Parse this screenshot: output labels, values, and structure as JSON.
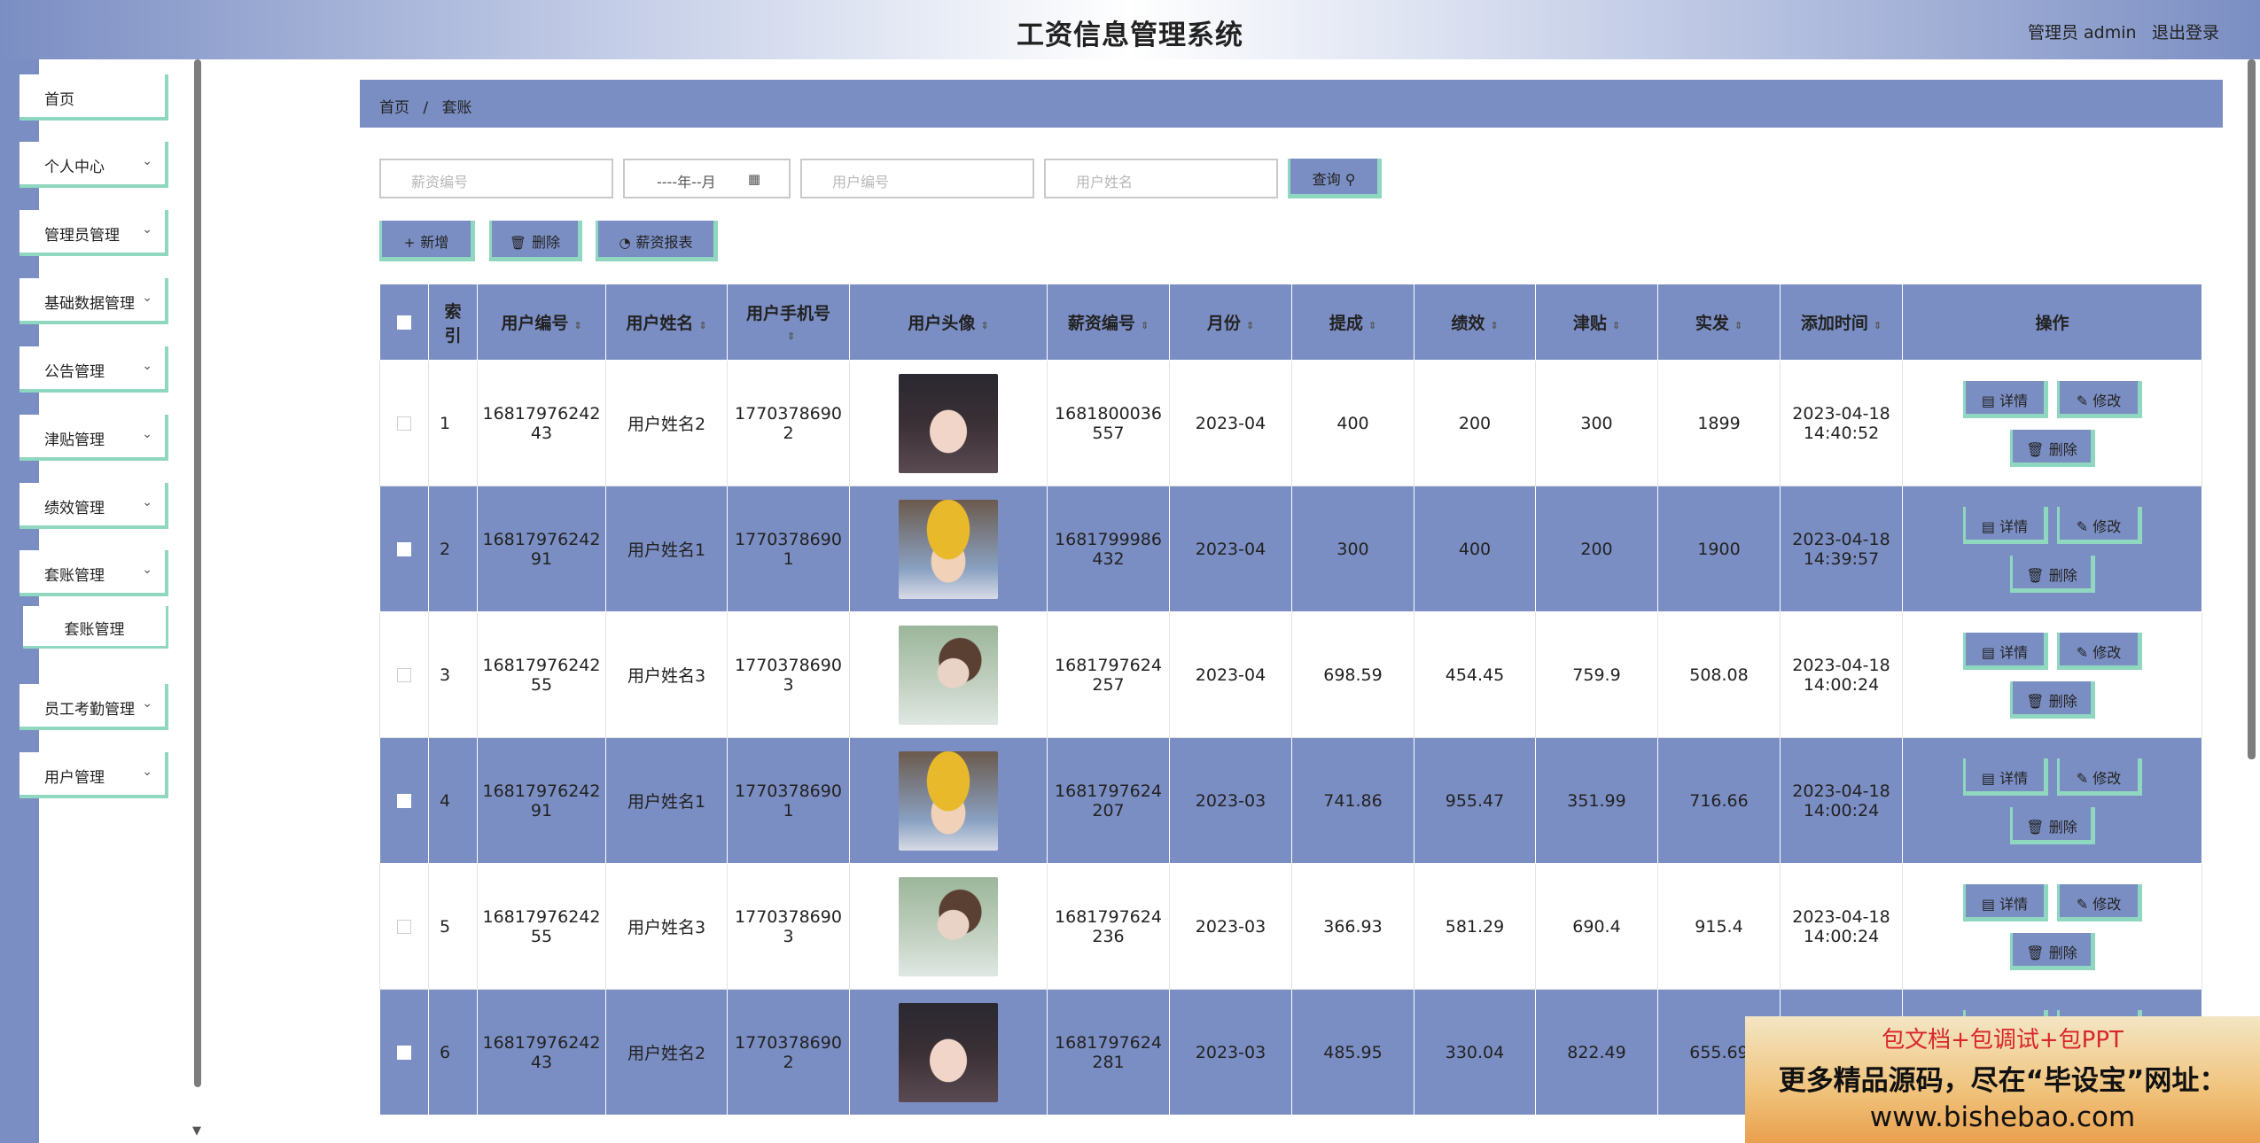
{
  "header": {
    "title": "工资信息管理系统",
    "user": "管理员 admin",
    "logout": "退出登录"
  },
  "sidebar": {
    "items": [
      {
        "label": "首页",
        "chev": ""
      },
      {
        "label": "个人中心",
        "chev": "⌄"
      },
      {
        "label": "管理员管理",
        "chev": "⌄"
      },
      {
        "label": "基础数据管理",
        "chev": "⌄"
      },
      {
        "label": "公告管理",
        "chev": "⌄"
      },
      {
        "label": "津贴管理",
        "chev": "⌄"
      },
      {
        "label": "绩效管理",
        "chev": "⌄"
      },
      {
        "label": "套账管理",
        "chev": "⌄"
      },
      {
        "label": "员工考勤管理",
        "chev": "⌄"
      },
      {
        "label": "用户管理",
        "chev": "⌄"
      }
    ],
    "sub_item": "套账管理"
  },
  "breadcrumb": {
    "home": "首页",
    "sep": "/",
    "current": "套账"
  },
  "search": {
    "salary_no_placeholder": "薪资编号",
    "month_value": "----年--月",
    "user_no_placeholder": "用户编号",
    "user_name_placeholder": "用户姓名",
    "query_label": "查询"
  },
  "actions": {
    "add": "新增",
    "delete": "删除",
    "report": "薪资报表"
  },
  "table": {
    "headers": {
      "index": "索引",
      "user_no": "用户编号",
      "user_name": "用户姓名",
      "phone": "用户手机号",
      "avatar": "用户头像",
      "salary_no": "薪资编号",
      "month": "月份",
      "commission": "提成",
      "performance": "绩效",
      "allowance": "津贴",
      "paid": "实发",
      "added": "添加时间",
      "ops": "操作"
    },
    "op_labels": {
      "detail": "详情",
      "edit": "修改",
      "delete": "删除"
    },
    "rows": [
      {
        "index": "1",
        "user_no": "1681797624243",
        "user_name": "用户姓名2",
        "phone": "17703786902",
        "avatar": "av-a",
        "salary_no": "1681800036557",
        "month": "2023-04",
        "commission": "400",
        "performance": "200",
        "allowance": "300",
        "paid": "1899",
        "date": "2023-04-18",
        "time": "14:40:52"
      },
      {
        "index": "2",
        "user_no": "1681797624291",
        "user_name": "用户姓名1",
        "phone": "17703786901",
        "avatar": "av-b",
        "salary_no": "1681799986432",
        "month": "2023-04",
        "commission": "300",
        "performance": "400",
        "allowance": "200",
        "paid": "1900",
        "date": "2023-04-18",
        "time": "14:39:57"
      },
      {
        "index": "3",
        "user_no": "1681797624255",
        "user_name": "用户姓名3",
        "phone": "17703786903",
        "avatar": "av-c",
        "salary_no": "1681797624257",
        "month": "2023-04",
        "commission": "698.59",
        "performance": "454.45",
        "allowance": "759.9",
        "paid": "508.08",
        "date": "2023-04-18",
        "time": "14:00:24"
      },
      {
        "index": "4",
        "user_no": "1681797624291",
        "user_name": "用户姓名1",
        "phone": "17703786901",
        "avatar": "av-b",
        "salary_no": "1681797624207",
        "month": "2023-03",
        "commission": "741.86",
        "performance": "955.47",
        "allowance": "351.99",
        "paid": "716.66",
        "date": "2023-04-18",
        "time": "14:00:24"
      },
      {
        "index": "5",
        "user_no": "1681797624255",
        "user_name": "用户姓名3",
        "phone": "17703786903",
        "avatar": "av-c",
        "salary_no": "1681797624236",
        "month": "2023-03",
        "commission": "366.93",
        "performance": "581.29",
        "allowance": "690.4",
        "paid": "915.4",
        "date": "2023-04-18",
        "time": "14:00:24"
      },
      {
        "index": "6",
        "user_no": "1681797624243",
        "user_name": "用户姓名2",
        "phone": "17703786902",
        "avatar": "av-a",
        "salary_no": "1681797624281",
        "month": "2023-03",
        "commission": "485.95",
        "performance": "330.04",
        "allowance": "822.49",
        "paid": "655.69",
        "date": "",
        "time": ""
      }
    ]
  },
  "watermark": {
    "line1": "包文档+包调试+包PPT",
    "line2": "更多精品源码，尽在“毕设宝”网址：",
    "line3": "www.bishebao.com"
  },
  "colors": {
    "primary": "#7b8ec3",
    "accent": "#8fd7bf"
  }
}
